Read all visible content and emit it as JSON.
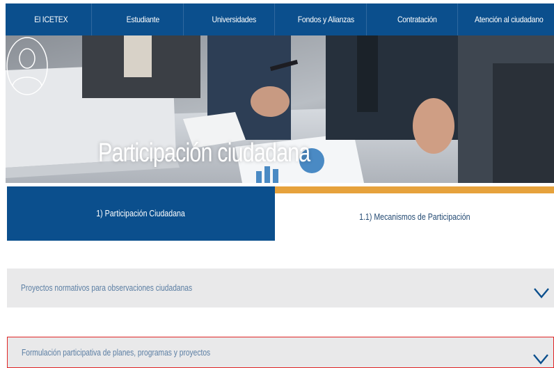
{
  "nav": {
    "items": [
      {
        "label": "El ICETEX"
      },
      {
        "label": "Estudiante"
      },
      {
        "label": "Universidades"
      },
      {
        "label": "Fondos y Alianzas"
      },
      {
        "label": "Contratación"
      },
      {
        "label": "Atención al ciudadano"
      }
    ]
  },
  "hero": {
    "title": "Participación ciudadana",
    "icon": "user-circle-icon"
  },
  "tabs": [
    {
      "label": "1) Participación Ciudadana",
      "active": true
    },
    {
      "label": "1.1) Mecanismos de Participación",
      "active": false
    }
  ],
  "accordions": [
    {
      "label": "Proyectos normativos para observaciones ciudadanas",
      "icon": "chevron-down-icon"
    },
    {
      "label": "Formulación participativa de planes, programas y proyectos",
      "icon": "chevron-down-icon",
      "highlighted": true
    }
  ],
  "colors": {
    "primary": "#0b4f8d",
    "accent": "#e6a23c",
    "accordion_bg": "#e9e9ea",
    "highlight_border": "#e02525"
  }
}
